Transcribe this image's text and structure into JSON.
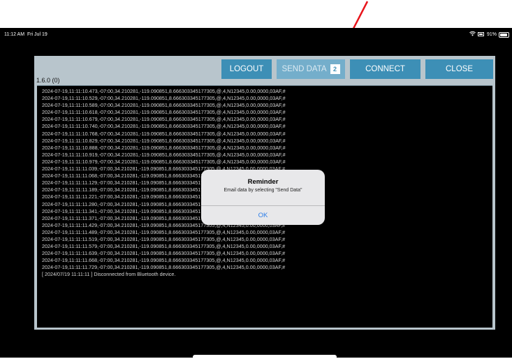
{
  "status_bar": {
    "time": "11:12 AM",
    "date": "Fri Jul 19",
    "battery": "91%",
    "battery_level": 0.91,
    "icons": [
      "wifi-icon",
      "battery-icon"
    ]
  },
  "toolbar": {
    "version": "1.6.0 (0)",
    "logout_label": "LOGOUT",
    "send_data_label": "SEND DATA",
    "send_data_count": "2",
    "connect_label": "CONNECT",
    "close_label": "CLOSE"
  },
  "log": {
    "lines": [
      "2024-07-19,11:11:10.473,-07:00,34.210281,-119.090851,8.666303345177305,@,4,N12345,0.00,0000,03AF,#",
      "2024-07-19,11:11:10.529,-07:00,34.210281,-119.090851,8.666303345177305,@,4,N12345,0.00,0000,03AF,#",
      "2024-07-19,11:11:10.589,-07:00,34.210281,-119.090851,8.666303345177305,@,4,N12345,0.00,0000,03AF,#",
      "2024-07-19,11:11:10.618,-07:00,34.210281,-119.090851,8.666303345177305,@,4,N12345,0.00,0000,03AF,#",
      "2024-07-19,11:11:10.679,-07:00,34.210281,-119.090851,8.666303345177305,@,4,N12345,0.00,0000,03AF,#",
      "2024-07-19,11:11:10.740,-07:00,34.210281,-119.090851,8.666303345177305,@,4,N12345,0.00,0000,03AF,#",
      "2024-07-19,11:11:10.768,-07:00,34.210281,-119.090851,8.666303345177305,@,4,N12345,0.00,0000,03AF,#",
      "2024-07-19,11:11:10.829,-07:00,34.210281,-119.090851,8.666303345177305,@,4,N12345,0.00,0000,03AF,#",
      "2024-07-19,11:11:10.888,-07:00,34.210281,-119.090851,8.666303345177305,@,4,N12345,0.00,0000,03AF,#",
      "2024-07-19,11:11:10.919,-07:00,34.210281,-119.090851,8.666303345177305,@,4,N12345,0.00,0000,03AF,#",
      "2024-07-19,11:11:10.979,-07:00,34.210281,-119.090851,8.666303345177305,@,4,N12345,0.00,0000,03AF,#",
      "2024-07-19,11:11:11.039,-07:00,34.210281,-119.090851,8.666303345177305,@,4,N12345,0.00,0000,03AF,#",
      "2024-07-19,11:11:11.068,-07:00,34.210281,-119.090851,8.666303345177305,@,4,N12345,0.00,0000,03AF,#",
      "2024-07-19,11:11:11.129,-07:00,34.210281,-119.090851,8.666303345177305,@,4,N12345,0.00,0000,03AF,#",
      "2024-07-19,11:11:11.189,-07:00,34.210281,-119.090851,8.666303345177305,@,4,N12345,0.00,0000,03AF,#",
      "2024-07-19,11:11:11.221,-07:00,34.210281,-119.090851,8.666303345177305,@,4,N12345,0.00,0000,03AF,#",
      "2024-07-19,11:11:11.280,-07:00,34.210281,-119.090851,8.666303345177305,@,4,N12345,0.00,0000,03AF,#",
      "2024-07-19,11:11:11.341,-07:00,34.210281,-119.090851,8.666303345177305,@,4,N12345,0.00,0000,03AF,#",
      "2024-07-19,11:11:11.371,-07:00,34.210281,-119.090851,8.666303345177305,@,4,N12345,0.00,0000,03AF,#",
      "2024-07-19,11:11:11.429,-07:00,34.210281,-119.090851,8.666303345177305,@,4,N12345,0.00,0000,03AF,#",
      "2024-07-19,11:11:11.489,-07:00,34.210281,-119.090851,8.666303345177305,@,4,N12345,0.00,0000,03AF,#",
      "2024-07-19,11:11:11.519,-07:00,34.210281,-119.090851,8.666303345177305,@,4,N12345,0.00,0000,03AF,#",
      "2024-07-19,11:11:11.579,-07:00,34.210281,-119.090851,8.666303345177305,@,4,N12345,0.00,0000,03AF,#",
      "2024-07-19,11:11:11.639,-07:00,34.210281,-119.090851,8.666303345177305,@,4,N12345,0.00,0000,03AF,#",
      "2024-07-19,11:11:11.668,-07:00,34.210281,-119.090851,8.666303345177305,@,4,N12345,0.00,0000,03AF,#",
      "2024-07-19,11:11:11.729,-07:00,34.210281,-119.090851,8.666303345177305,@,4,N12345,0.00,0000,03AF,#",
      "[ 2024/07/19 11:11:11 ] Disconnected from Bluetooth device."
    ]
  },
  "dialog": {
    "title": "Reminder",
    "message": "Email data by selecting \"Send Data\"",
    "ok_label": "OK"
  },
  "colors": {
    "accent": "#3d8fb6",
    "panel": "#b8c5cc",
    "annotation": "#e8141b"
  }
}
